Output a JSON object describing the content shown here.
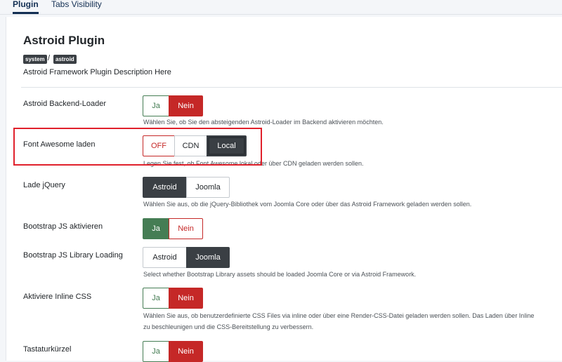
{
  "tabs": [
    {
      "label": "Plugin"
    },
    {
      "label": "Tabs Visibility"
    }
  ],
  "header": {
    "title": "Astroid Plugin",
    "badges": [
      "system",
      "astroid"
    ],
    "separator": "/",
    "description": "Astroid Framework Plugin Description Here"
  },
  "settings": [
    {
      "label": "Astroid Backend-Loader",
      "options": [
        "Ja",
        "Nein"
      ],
      "selected": "Nein",
      "help": "Wählen Sie, ob Sie den absteigenden Astroid-Loader im Backend aktivieren möchten."
    },
    {
      "label": "Font Awesome laden",
      "options": [
        "OFF",
        "CDN",
        "Local"
      ],
      "selected": "Local",
      "help": "Legen Sie fest, ob Font Awesome lokal oder über CDN geladen werden sollen."
    },
    {
      "label": "Lade jQuery",
      "options": [
        "Astroid",
        "Joomla"
      ],
      "selected": "Astroid",
      "help": "Wählen Sie aus, ob die jQuery-Bibliothek vom Joomla Core oder über das Astroid Framework geladen werden sollen."
    },
    {
      "label": "Bootstrap JS aktivieren",
      "options": [
        "Ja",
        "Nein"
      ],
      "selected": "Ja",
      "help": ""
    },
    {
      "label": "Bootstrap JS Library Loading",
      "options": [
        "Astroid",
        "Joomla"
      ],
      "selected": "Joomla",
      "help": "Select whether Bootstrap Library assets should be loaded Joomla Core or via Astroid Framework."
    },
    {
      "label": "Aktiviere Inline CSS",
      "options": [
        "Ja",
        "Nein"
      ],
      "selected": "Nein",
      "help": "Wählen Sie aus, ob benutzerdefinierte CSS Files via inline oder über eine Render-CSS-Datei geladen werden sollen. Das Laden über Inline",
      "help2": "zu beschleunigen und die CSS-Bereitstellung zu verbessern."
    },
    {
      "label": "Tastaturkürzel",
      "options": [
        "Ja",
        "Nein"
      ],
      "selected": "Nein",
      "help": ""
    }
  ],
  "colors": {
    "accent_red": "#c52827",
    "accent_green": "#457d54",
    "dark": "#3a3f44",
    "annotation": "#e0212c"
  }
}
